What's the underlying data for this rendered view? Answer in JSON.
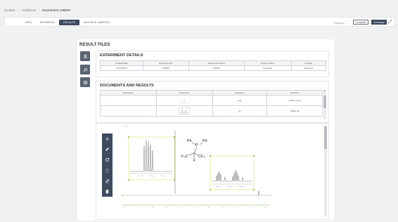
{
  "breadcrumb": {
    "items": [
      "Studies",
      "Analytical",
      "Experiment 138645"
    ]
  },
  "tabs": [
    {
      "label": "INFO"
    },
    {
      "label": "NOTEBOOK"
    },
    {
      "label": "RESULTS"
    },
    {
      "label": "MULTIPLE SAMPLES"
    }
  ],
  "header": {
    "options_label": "Options",
    "complete_label": "Complete",
    "summary_label": "Summary"
  },
  "result_files": {
    "title": "RESULT FILES"
  },
  "experiment_details": {
    "title": "EXPERIMENT DETAILS",
    "columns": [
      "Created Date",
      "Experiment ID",
      "Experiment Name",
      "Protocol Name",
      "Created"
    ],
    "row": [
      "09/17/2019",
      "138645",
      "138645",
      "Analytical",
      "bsizemore"
    ]
  },
  "documents": {
    "title": "DOCUMENTS AND RESULTS",
    "columns": [
      "Description",
      "Document",
      "Extension",
      "Filename"
    ],
    "rows": [
      {
        "description": "",
        "extension": "png",
        "filename": "LCMS_1.png"
      },
      {
        "description": "",
        "extension": "gif",
        "filename": "NMR2.gif"
      }
    ]
  },
  "molecule": {
    "ph_left": "Ph",
    "ph_right": "Ph",
    "p": "P",
    "f3c": "F₃C",
    "cf3": "CF₃",
    "f": "F"
  },
  "colors": {
    "accent": "#3e4a5e",
    "spectrum_frame": "#d9e06a",
    "marker": "#7cb342"
  }
}
